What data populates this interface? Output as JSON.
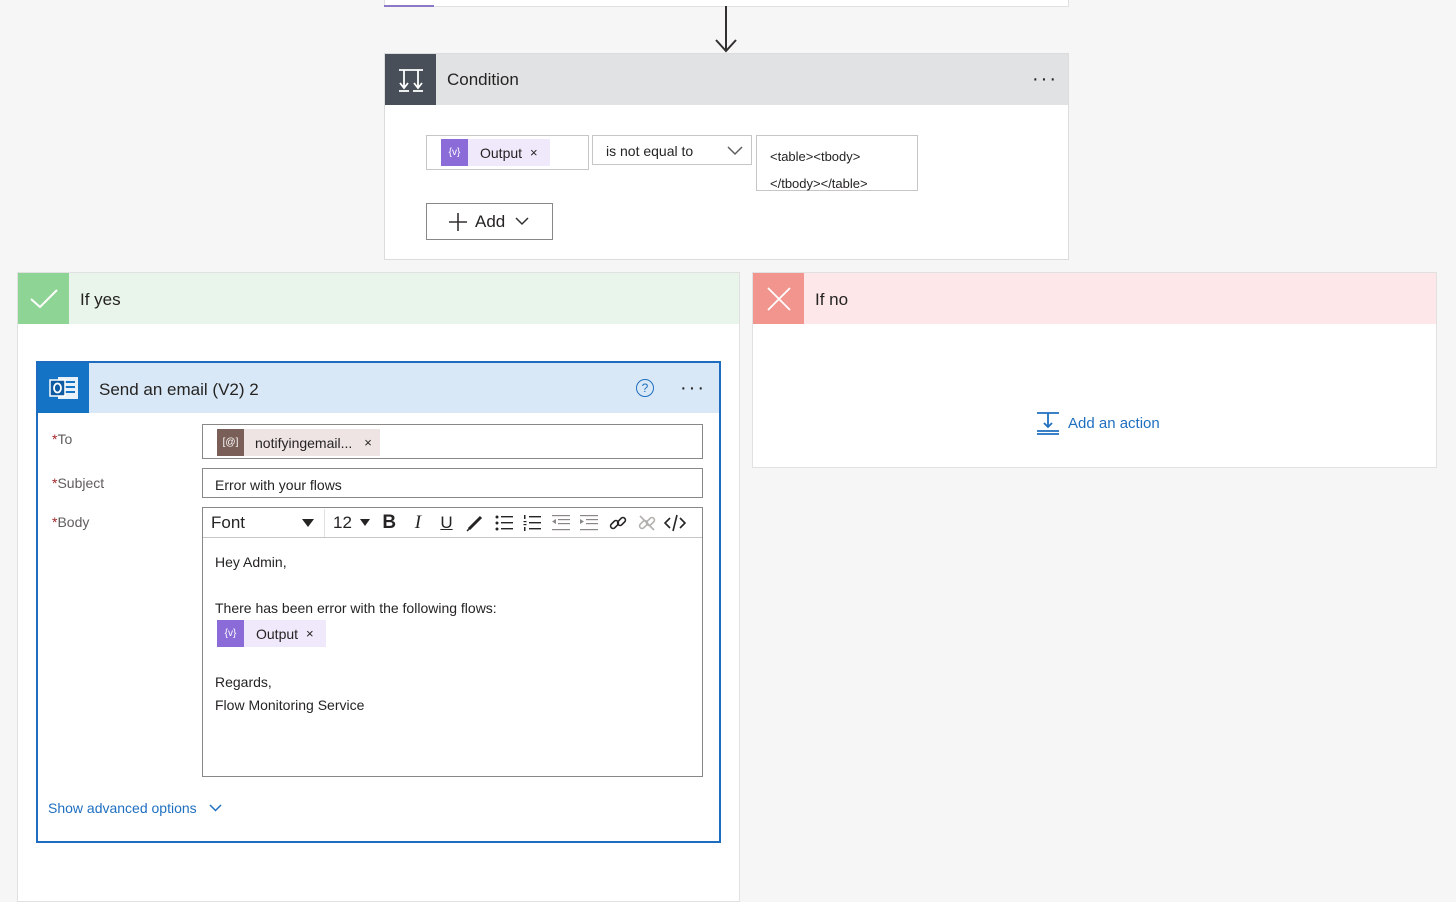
{
  "condition": {
    "title": "Condition",
    "more_label": "···",
    "left_operand": {
      "label": "Output",
      "remove": "×",
      "icon": "variable-icon"
    },
    "operator": "is not equal to",
    "right_value_line1": "<table><tbody>",
    "right_value_line2": "</tbody></table>",
    "add_label": "Add"
  },
  "branches": {
    "yes": {
      "title": "If yes"
    },
    "no": {
      "title": "If no",
      "add_action_label": "Add an action"
    }
  },
  "email_action": {
    "title": "Send an email (V2) 2",
    "help_label": "?",
    "more_label": "···",
    "required_mark": "*",
    "to": {
      "label": "To",
      "token_label": "notifyingemail...",
      "token_remove": "×"
    },
    "subject": {
      "label": "Subject",
      "value": "Error with your flows"
    },
    "body": {
      "label": "Body",
      "toolbar": {
        "font": "Font",
        "size": "12"
      },
      "line1": "Hey Admin,",
      "line2": "There has been error with the following flows:",
      "token": {
        "label": "Output",
        "remove": "×"
      },
      "line3": "Regards,",
      "line4": "Flow Monitoring Service"
    },
    "advanced_label": "Show advanced options"
  },
  "colors": {
    "accent": "#1d6cbf",
    "condition_header": "#484f58",
    "yes_green": "#8ed494",
    "no_red": "#f2958f",
    "token_purple": "#8a6bd7",
    "link_blue": "#1f6fc0"
  }
}
